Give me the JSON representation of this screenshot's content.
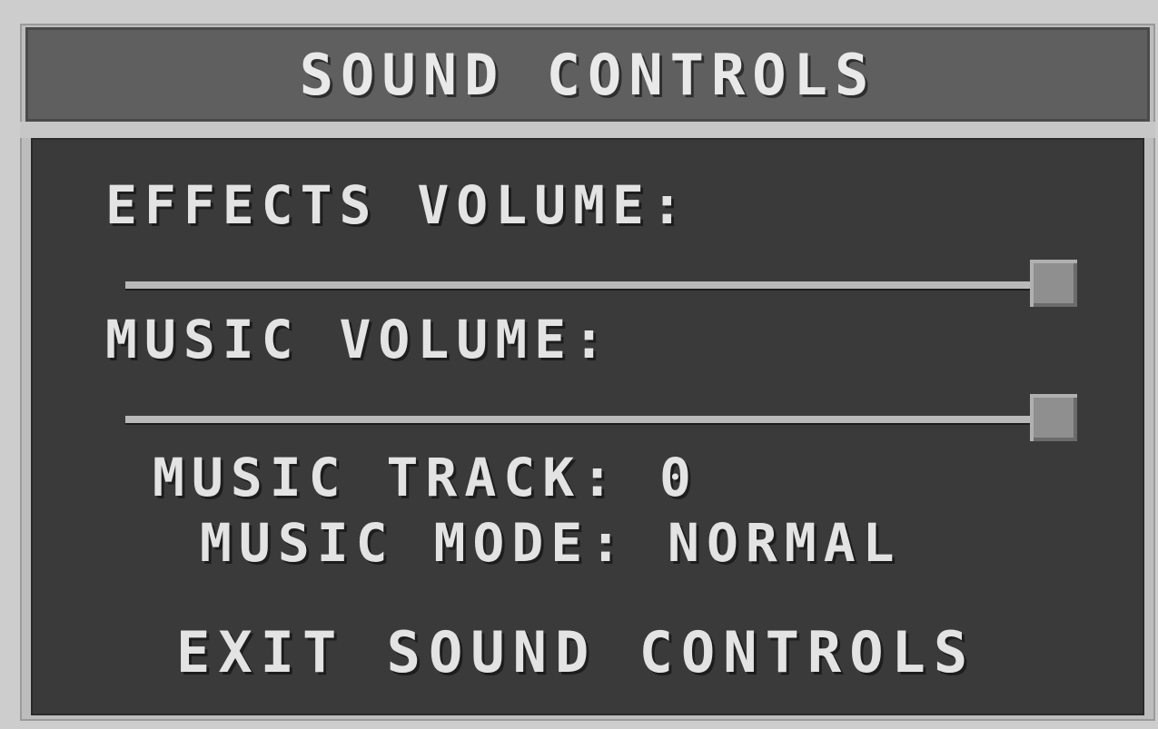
{
  "window": {
    "title": "SOUND CONTROLS"
  },
  "effects_volume": {
    "label": "EFFECTS VOLUME:",
    "level": 1.0
  },
  "music_volume": {
    "label": "MUSIC VOLUME:",
    "level": 1.0
  },
  "music_track": {
    "text": "MUSIC TRACK: 0"
  },
  "music_mode": {
    "text": "MUSIC MODE: NORMAL"
  },
  "exit": {
    "label": "EXIT SOUND CONTROLS"
  }
}
